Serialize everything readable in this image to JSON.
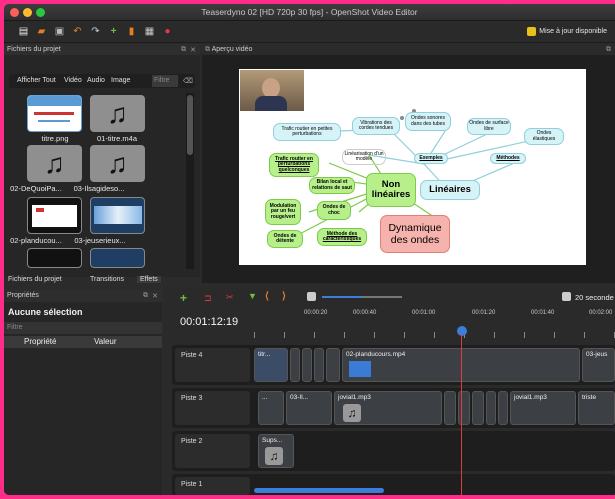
{
  "window": {
    "title": "Teaserdyno 02 [HD 720p 30 fps] - OpenShot Video Editor"
  },
  "toolbar": {
    "update_label": "Mise à jour disponible"
  },
  "project_files": {
    "title": "Fichiers du projet",
    "filters": {
      "all": "Afficher Tout",
      "video": "Vidéo",
      "audio": "Audio",
      "image": "Image",
      "filter_placeholder": "Filtre"
    },
    "items": [
      {
        "name": "titre.png"
      },
      {
        "name": "01-titre.m4a"
      },
      {
        "name": "02-DeQuoiPa..."
      },
      {
        "name": "03-Ilsagideso..."
      },
      {
        "name": "02-planducou..."
      },
      {
        "name": "03-jeuserieux..."
      }
    ]
  },
  "bottom_tabs": {
    "files": "Fichiers du projet",
    "transitions": "Transitions",
    "effects": "Effets"
  },
  "properties": {
    "title": "Propriétés",
    "selection": "Aucune sélection",
    "filter_placeholder": "Filtre",
    "col_property": "Propriété",
    "col_value": "Valeur"
  },
  "preview": {
    "title": "Aperçu vidéo",
    "nodes": {
      "trafic": "Trafic routier en petites perturbations",
      "vibrations": "Vibrations des cordes tendues",
      "ondes_sonores": "Ondes sonores dans des tubes",
      "ondes_surface": "Ondes de surface libre",
      "ondes_elastiques": "Ondes élastiques",
      "trafic2": "Trafic routier en perturbations quelconques",
      "linearisation": "Linéarisation d'un modèle",
      "exemples": "Exemples",
      "methodes": "Méthodes",
      "bilan": "Bilan local et relations de saut",
      "non_lineaires": "Non linéaires",
      "lineaires": "Linéaires",
      "modulation": "Modulation par un feu rouge/vert",
      "ondes_choc": "Ondes de choc",
      "ondes_detente": "Ondes de détente",
      "methode_car": "Méthode des caractéristiques",
      "dynamique": "Dynamique des ondes"
    }
  },
  "timeline": {
    "timecode": "00:01:12:19",
    "zoom_label": "20 seconde",
    "ruler": [
      "00:00:20",
      "00:00:40",
      "00:01:00",
      "00:01:20",
      "00:01:40",
      "00:02:00"
    ],
    "tracks": [
      {
        "name": "Piste 4",
        "clips": [
          "titr...",
          "02-planducours.mp4",
          "03-jeus"
        ]
      },
      {
        "name": "Piste 3",
        "clips": [
          "...",
          "03-Il...",
          "jovial1.mp3",
          "jovial1.mp3",
          "triste"
        ]
      },
      {
        "name": "Piste 2",
        "clips": [
          "Sups..."
        ]
      },
      {
        "name": "Piste 1",
        "clips": []
      }
    ]
  },
  "colors": {
    "accent_green": "#6fbf3a",
    "playhead": "#e0393e",
    "node_green": "#b7f08a",
    "node_blue": "#d6f3f8",
    "node_red": "#f6b3ad"
  }
}
